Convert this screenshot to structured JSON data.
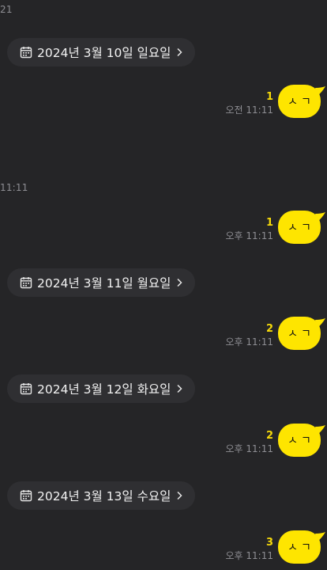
{
  "colors": {
    "background": "#252527",
    "chip_background": "#2f2f32",
    "bubble": "#fee500",
    "unread": "#f5d90a",
    "timestamp": "#8e8e93"
  },
  "header": {
    "top_time_fragment": "21",
    "mid_time_fragment": "11:11"
  },
  "dates": [
    {
      "label": "2024년 3월 10일 일요일",
      "icon": "calendar-icon",
      "chevron": "chevron-right-icon"
    },
    {
      "label": "2024년 3월 11일 월요일",
      "icon": "calendar-icon",
      "chevron": "chevron-right-icon"
    },
    {
      "label": "2024년 3월 12일 화요일",
      "icon": "calendar-icon",
      "chevron": "chevron-right-icon"
    },
    {
      "label": "2024년 3월 13일 수요일",
      "icon": "calendar-icon",
      "chevron": "chevron-right-icon"
    }
  ],
  "messages": [
    {
      "text": "ㅅㄱ",
      "unread": "1",
      "time": "오전 11:11"
    },
    {
      "text": "ㅅㄱ",
      "unread": "1",
      "time": "오후 11:11"
    },
    {
      "text": "ㅅㄱ",
      "unread": "2",
      "time": "오후 11:11"
    },
    {
      "text": "ㅅㄱ",
      "unread": "2",
      "time": "오후 11:11"
    },
    {
      "text": "ㅅㄱ",
      "unread": "3",
      "time": "오후 11:11"
    }
  ]
}
